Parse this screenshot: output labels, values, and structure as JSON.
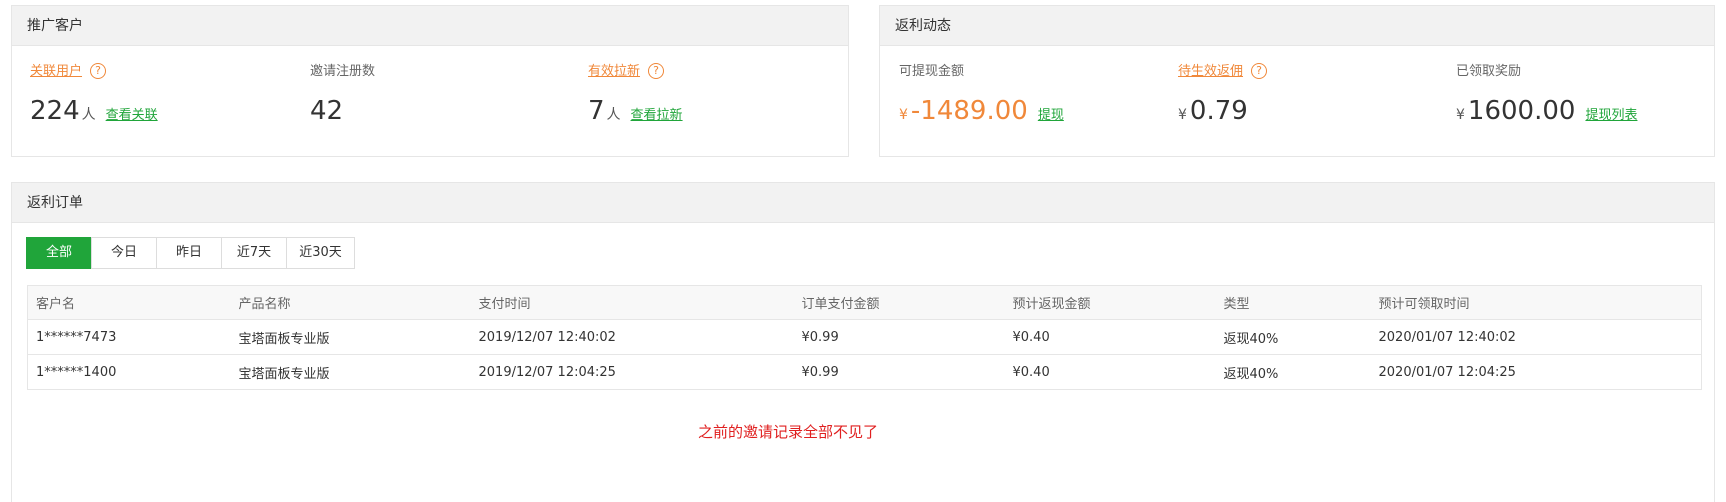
{
  "promo": {
    "title": "推广客户",
    "linked_users_label": "关联用户",
    "linked_users_value": "224",
    "linked_users_unit": "人",
    "linked_users_link": "查看关联",
    "registrations_label": "邀请注册数",
    "registrations_value": "42",
    "effective_label": "有效拉新",
    "effective_value": "7",
    "effective_unit": "人",
    "effective_link": "查看拉新"
  },
  "rebate": {
    "title": "返利动态",
    "withdrawable_label": "可提现金额",
    "withdrawable_currency": "¥",
    "withdrawable_value": "-1489.00",
    "withdraw_link": "提现",
    "pending_label": "待生效返佣",
    "pending_currency": "¥",
    "pending_value": "0.79",
    "received_label": "已领取奖励",
    "received_currency": "¥",
    "received_value": "1600.00",
    "withdraw_list_link": "提现列表"
  },
  "help_glyph": "?",
  "orders": {
    "title": "返利订单",
    "filters": [
      "全部",
      "今日",
      "昨日",
      "近7天",
      "近30天"
    ],
    "columns": [
      "客户名",
      "产品名称",
      "支付时间",
      "订单支付金额",
      "预计返现金额",
      "类型",
      "预计可领取时间"
    ],
    "rows": [
      [
        "1******7473",
        "宝塔面板专业版",
        "2019/12/07 12:40:02",
        "¥0.99",
        "¥0.40",
        "返现40%",
        "2020/01/07 12:40:02"
      ],
      [
        "1******1400",
        "宝塔面板专业版",
        "2019/12/07 12:04:25",
        "¥0.99",
        "¥0.40",
        "返现40%",
        "2020/01/07 12:04:25"
      ]
    ]
  },
  "annotation": "之前的邀请记录全部不见了",
  "colors": {
    "accent_green": "#20a53a",
    "accent_orange": "#f0883a",
    "annotation_red": "#e02020"
  }
}
